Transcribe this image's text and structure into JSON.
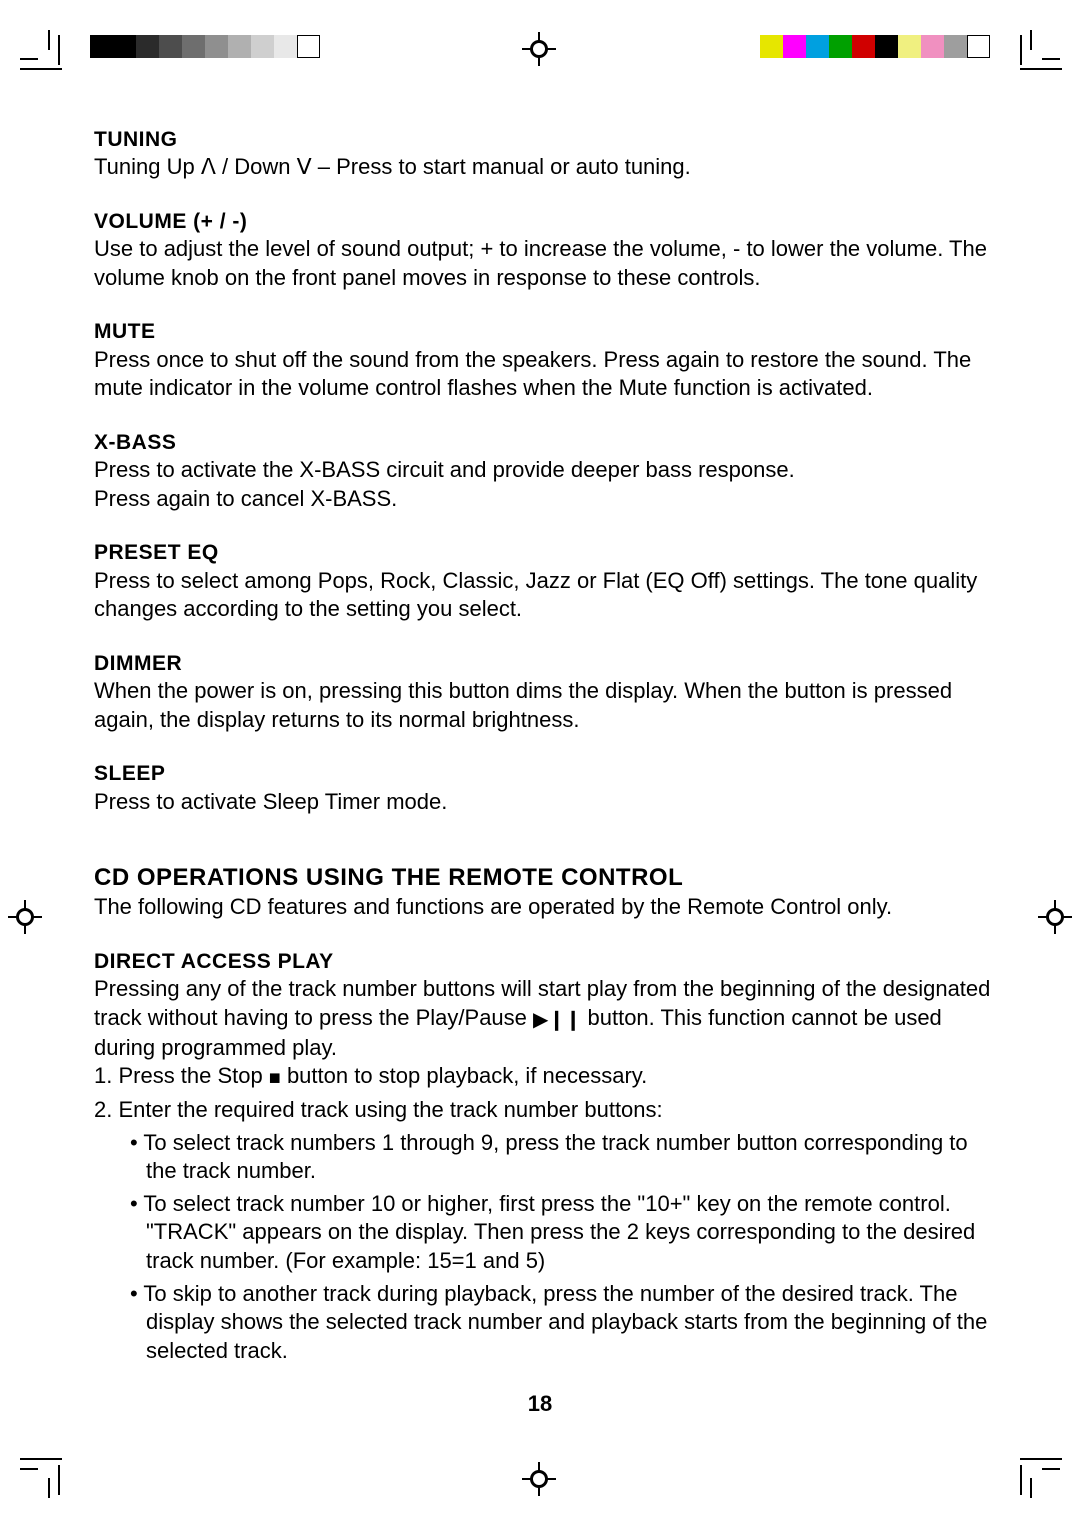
{
  "page_number": "18",
  "swatches": {
    "gray": [
      "#000000",
      "#000000",
      "#2b2b2b",
      "#4d4d4d",
      "#6e6e6e",
      "#8f8f8f",
      "#b0b0b0",
      "#cfcfcf",
      "#e8e8e8",
      "#ffffff"
    ],
    "color": [
      "#e6e600",
      "#ff00ff",
      "#00a0e0",
      "#00a000",
      "#d00000",
      "#000000",
      "#f0f080",
      "#f090c0",
      "#9e9e9e",
      "#ffffff"
    ]
  },
  "sections": {
    "tuning": {
      "heading": "TUNING",
      "line_pre": "Tuning Up ",
      "up_sym": "ᐱ",
      "line_mid": " / Down ",
      "down_sym": "ᐯ",
      "line_post": " – Press to start manual or auto tuning."
    },
    "volume": {
      "heading": "VOLUME  (+ / -)",
      "body": "Use to adjust  the level of sound output;  + to increase the volume,  - to lower the volume. The volume knob on the front panel moves in response to these controls."
    },
    "mute": {
      "heading": "MUTE",
      "body": "Press once to shut off the sound from the speakers. Press again to restore the sound.  The mute indicator in the volume control flashes when the Mute function is activated."
    },
    "xbass": {
      "heading": "X-BASS",
      "line1": "Press to activate the X-BASS circuit and provide deeper bass response.",
      "line2": "Press again to cancel X-BASS."
    },
    "preseteq": {
      "heading": "PRESET EQ",
      "body": "Press to select among Pops, Rock, Classic, Jazz or Flat (EQ Off) settings.  The tone quality changes according to the setting you select."
    },
    "dimmer": {
      "heading": "DIMMER",
      "body": "When the power is on, pressing this button dims the display.  When the button is pressed again, the display returns to its normal brightness."
    },
    "sleep": {
      "heading": "SLEEP",
      "body": "Press to activate Sleep Timer mode."
    },
    "cdops": {
      "heading": "CD OPERATIONS USING THE REMOTE CONTROL",
      "intro": "The following CD features and functions are operated by the Remote Control only."
    },
    "direct": {
      "heading": "DIRECT ACCESS PLAY",
      "intro_pre": "Pressing any of the track number buttons will start play from the beginning of the designated track without having to press the Play/Pause ",
      "play_sym": "▶❙❙",
      "intro_post": " button.  This function cannot be used during programmed play.",
      "step1_pre": "1.  Press the Stop ",
      "stop_sym": "■",
      "step1_post": " button to stop playback, if necessary.",
      "step2": "2.  Enter the required track using the track number buttons:",
      "bullet1": "To select  track numbers 1 through 9, press the track number button corresponding to the track number.",
      "bullet2": "To select track number 10 or higher, first press the \"10+\" key on the remote control.  \"TRACK\" appears on the display.  Then press the 2 keys corresponding to the desired track number. (For example: 15=1 and 5)",
      "bullet3": "To skip to another track during playback, press the number of the desired track. The display shows the selected track number and playback starts from the beginning of the selected track."
    }
  }
}
